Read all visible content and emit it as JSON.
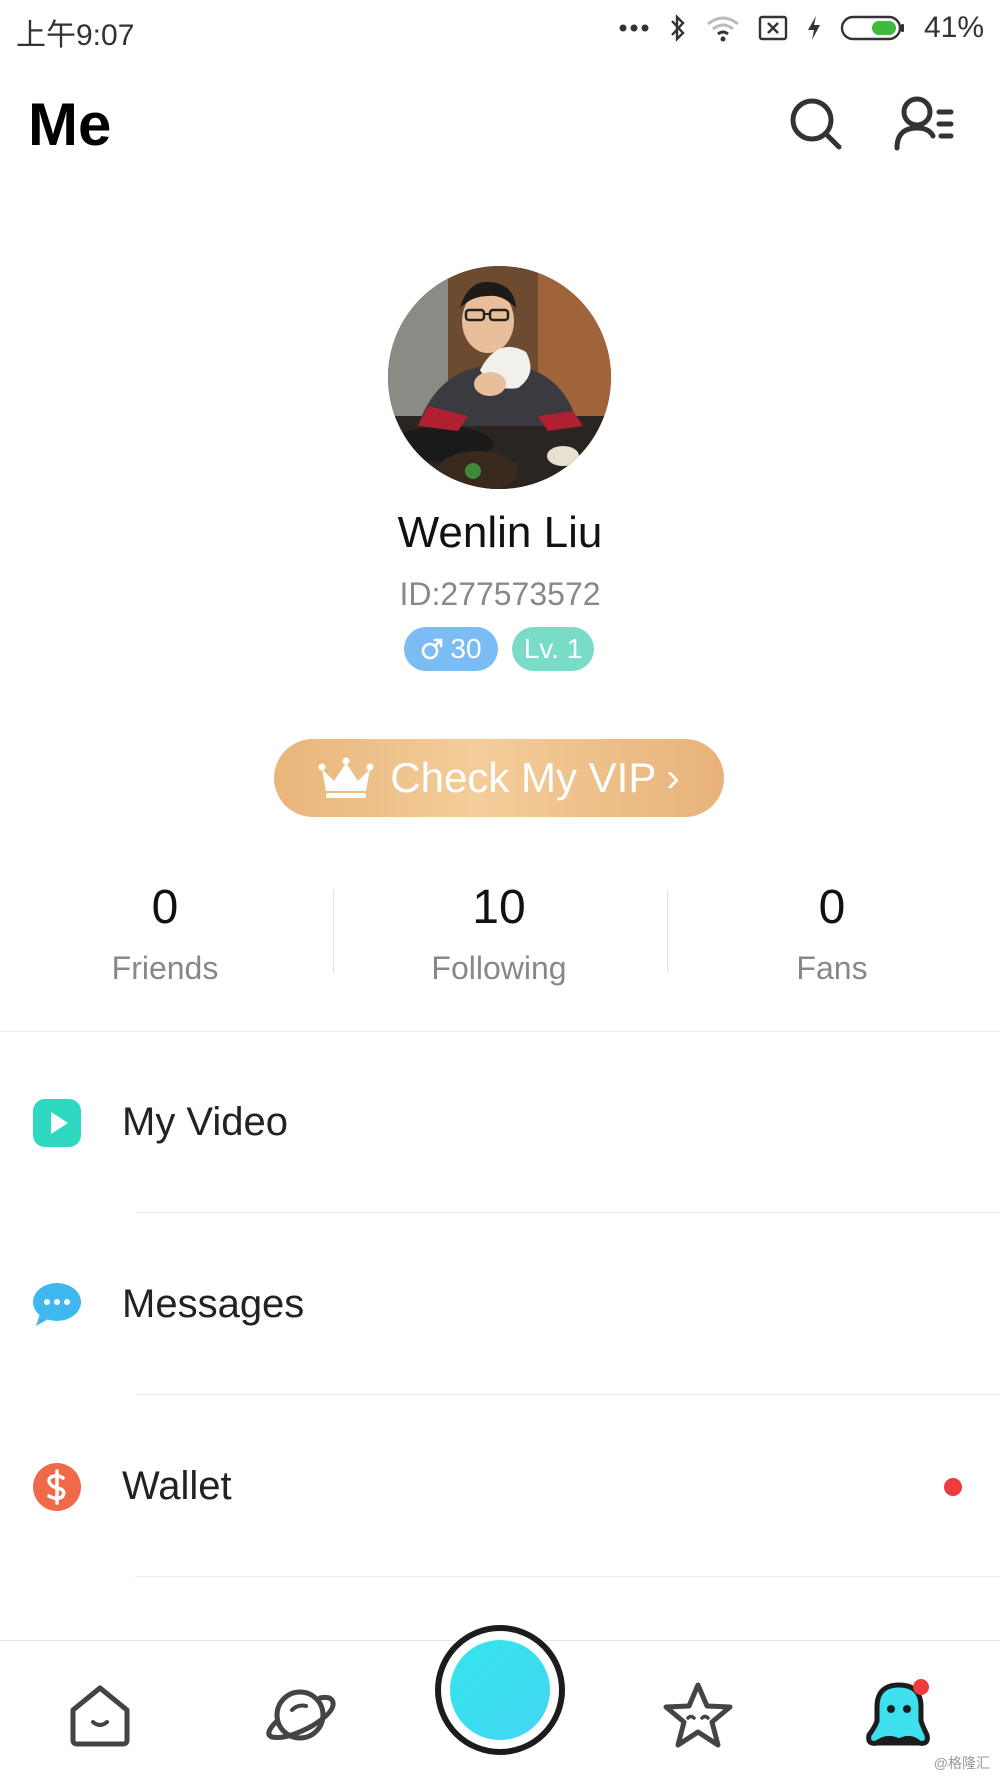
{
  "status_bar": {
    "time": "上午9:07",
    "battery": "41%"
  },
  "header": {
    "title": "Me"
  },
  "profile": {
    "name": "Wenlin Liu",
    "id": "ID:277573572",
    "age_badge": "30",
    "level_badge": "Lv. 1"
  },
  "vip": {
    "label": "Check My VIP"
  },
  "stats": {
    "friends": {
      "value": "0",
      "label": "Friends"
    },
    "following": {
      "value": "10",
      "label": "Following"
    },
    "fans": {
      "value": "0",
      "label": "Fans"
    }
  },
  "menu": {
    "items": [
      {
        "label": "My Video",
        "icon": "play-icon",
        "color": "#2fd8c0"
      },
      {
        "label": "Messages",
        "icon": "chat-bubble-icon",
        "color": "#3fb8f0"
      },
      {
        "label": "Wallet",
        "icon": "dollar-icon",
        "color": "#f06a4a"
      }
    ]
  },
  "bottom_nav": {
    "items": [
      "home-icon",
      "planet-icon",
      "record-button",
      "star-icon",
      "me-icon"
    ]
  },
  "watermark": "@格隆汇",
  "colors": {
    "accent_cyan": "#3ee0f0",
    "vip_gold": "#ecba82",
    "badge_blue": "#7cbcf5",
    "badge_teal": "#78dcc7",
    "notification_red": "#ee3b3b"
  }
}
